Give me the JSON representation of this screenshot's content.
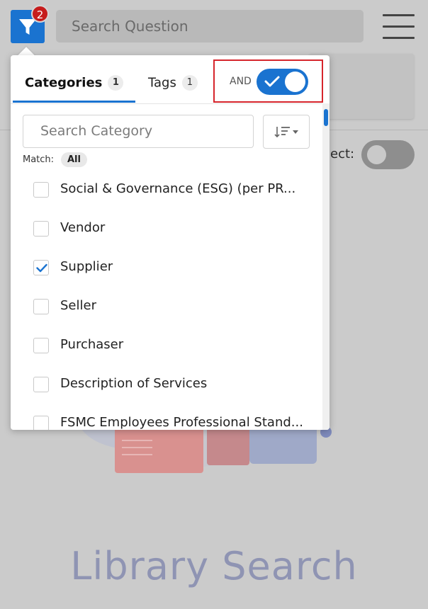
{
  "toolbar": {
    "filter_badge": "2",
    "search_placeholder": "Search Question"
  },
  "background": {
    "toggle_label": "ect:",
    "title": "Library Search"
  },
  "panel": {
    "tabs": [
      {
        "label": "Categories",
        "count": "1",
        "active": true
      },
      {
        "label": "Tags",
        "count": "1",
        "active": false
      }
    ],
    "operator_label": "AND",
    "operator_toggle_on": true,
    "search_placeholder": "Search Category",
    "match_label": "Match:",
    "match_value": "All",
    "items": [
      {
        "label": "Social & Governance (ESG) (per PR...",
        "checked": false
      },
      {
        "label": "Vendor",
        "checked": false
      },
      {
        "label": "Supplier",
        "checked": true
      },
      {
        "label": "Seller",
        "checked": false
      },
      {
        "label": "Purchaser",
        "checked": false
      },
      {
        "label": "Description of Services",
        "checked": false
      },
      {
        "label": "FSMC Employees Professional Stand...",
        "checked": false
      }
    ]
  },
  "colors": {
    "accent": "#1a73d0",
    "badge": "#c61c1c",
    "highlight": "#d6252c"
  }
}
